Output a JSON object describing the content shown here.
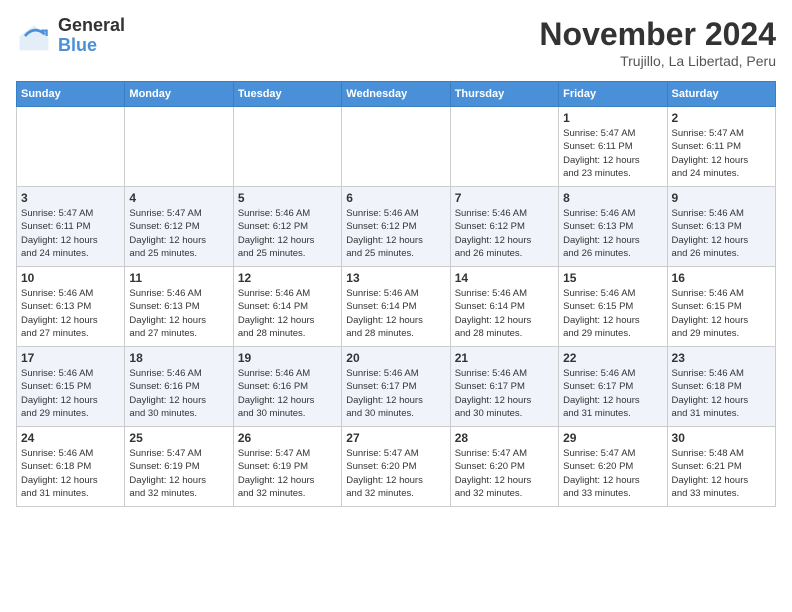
{
  "logo": {
    "text_general": "General",
    "text_blue": "Blue"
  },
  "title": "November 2024",
  "subtitle": "Trujillo, La Libertad, Peru",
  "days_of_week": [
    "Sunday",
    "Monday",
    "Tuesday",
    "Wednesday",
    "Thursday",
    "Friday",
    "Saturday"
  ],
  "weeks": [
    [
      {
        "day": "",
        "info": ""
      },
      {
        "day": "",
        "info": ""
      },
      {
        "day": "",
        "info": ""
      },
      {
        "day": "",
        "info": ""
      },
      {
        "day": "",
        "info": ""
      },
      {
        "day": "1",
        "info": "Sunrise: 5:47 AM\nSunset: 6:11 PM\nDaylight: 12 hours\nand 23 minutes."
      },
      {
        "day": "2",
        "info": "Sunrise: 5:47 AM\nSunset: 6:11 PM\nDaylight: 12 hours\nand 24 minutes."
      }
    ],
    [
      {
        "day": "3",
        "info": "Sunrise: 5:47 AM\nSunset: 6:11 PM\nDaylight: 12 hours\nand 24 minutes."
      },
      {
        "day": "4",
        "info": "Sunrise: 5:47 AM\nSunset: 6:12 PM\nDaylight: 12 hours\nand 25 minutes."
      },
      {
        "day": "5",
        "info": "Sunrise: 5:46 AM\nSunset: 6:12 PM\nDaylight: 12 hours\nand 25 minutes."
      },
      {
        "day": "6",
        "info": "Sunrise: 5:46 AM\nSunset: 6:12 PM\nDaylight: 12 hours\nand 25 minutes."
      },
      {
        "day": "7",
        "info": "Sunrise: 5:46 AM\nSunset: 6:12 PM\nDaylight: 12 hours\nand 26 minutes."
      },
      {
        "day": "8",
        "info": "Sunrise: 5:46 AM\nSunset: 6:13 PM\nDaylight: 12 hours\nand 26 minutes."
      },
      {
        "day": "9",
        "info": "Sunrise: 5:46 AM\nSunset: 6:13 PM\nDaylight: 12 hours\nand 26 minutes."
      }
    ],
    [
      {
        "day": "10",
        "info": "Sunrise: 5:46 AM\nSunset: 6:13 PM\nDaylight: 12 hours\nand 27 minutes."
      },
      {
        "day": "11",
        "info": "Sunrise: 5:46 AM\nSunset: 6:13 PM\nDaylight: 12 hours\nand 27 minutes."
      },
      {
        "day": "12",
        "info": "Sunrise: 5:46 AM\nSunset: 6:14 PM\nDaylight: 12 hours\nand 28 minutes."
      },
      {
        "day": "13",
        "info": "Sunrise: 5:46 AM\nSunset: 6:14 PM\nDaylight: 12 hours\nand 28 minutes."
      },
      {
        "day": "14",
        "info": "Sunrise: 5:46 AM\nSunset: 6:14 PM\nDaylight: 12 hours\nand 28 minutes."
      },
      {
        "day": "15",
        "info": "Sunrise: 5:46 AM\nSunset: 6:15 PM\nDaylight: 12 hours\nand 29 minutes."
      },
      {
        "day": "16",
        "info": "Sunrise: 5:46 AM\nSunset: 6:15 PM\nDaylight: 12 hours\nand 29 minutes."
      }
    ],
    [
      {
        "day": "17",
        "info": "Sunrise: 5:46 AM\nSunset: 6:15 PM\nDaylight: 12 hours\nand 29 minutes."
      },
      {
        "day": "18",
        "info": "Sunrise: 5:46 AM\nSunset: 6:16 PM\nDaylight: 12 hours\nand 30 minutes."
      },
      {
        "day": "19",
        "info": "Sunrise: 5:46 AM\nSunset: 6:16 PM\nDaylight: 12 hours\nand 30 minutes."
      },
      {
        "day": "20",
        "info": "Sunrise: 5:46 AM\nSunset: 6:17 PM\nDaylight: 12 hours\nand 30 minutes."
      },
      {
        "day": "21",
        "info": "Sunrise: 5:46 AM\nSunset: 6:17 PM\nDaylight: 12 hours\nand 30 minutes."
      },
      {
        "day": "22",
        "info": "Sunrise: 5:46 AM\nSunset: 6:17 PM\nDaylight: 12 hours\nand 31 minutes."
      },
      {
        "day": "23",
        "info": "Sunrise: 5:46 AM\nSunset: 6:18 PM\nDaylight: 12 hours\nand 31 minutes."
      }
    ],
    [
      {
        "day": "24",
        "info": "Sunrise: 5:46 AM\nSunset: 6:18 PM\nDaylight: 12 hours\nand 31 minutes."
      },
      {
        "day": "25",
        "info": "Sunrise: 5:47 AM\nSunset: 6:19 PM\nDaylight: 12 hours\nand 32 minutes."
      },
      {
        "day": "26",
        "info": "Sunrise: 5:47 AM\nSunset: 6:19 PM\nDaylight: 12 hours\nand 32 minutes."
      },
      {
        "day": "27",
        "info": "Sunrise: 5:47 AM\nSunset: 6:20 PM\nDaylight: 12 hours\nand 32 minutes."
      },
      {
        "day": "28",
        "info": "Sunrise: 5:47 AM\nSunset: 6:20 PM\nDaylight: 12 hours\nand 32 minutes."
      },
      {
        "day": "29",
        "info": "Sunrise: 5:47 AM\nSunset: 6:20 PM\nDaylight: 12 hours\nand 33 minutes."
      },
      {
        "day": "30",
        "info": "Sunrise: 5:48 AM\nSunset: 6:21 PM\nDaylight: 12 hours\nand 33 minutes."
      }
    ]
  ]
}
